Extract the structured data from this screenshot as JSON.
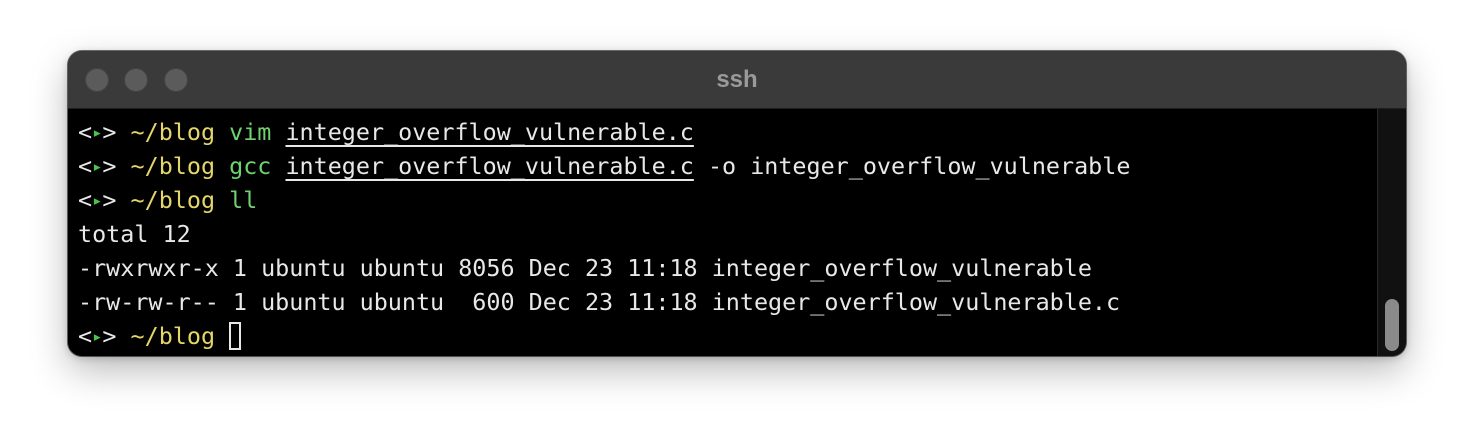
{
  "window": {
    "title": "ssh"
  },
  "colors": {
    "prompt_arrow": "#4cc34c",
    "directory": "#e5d66a",
    "command": "#6fd16f",
    "text": "#e8e8e8",
    "background": "#000000"
  },
  "terminal": {
    "prompt": {
      "lt": "<",
      "arrow": "▸",
      "gt": ">",
      "dir": "~/blog"
    },
    "lines": [
      {
        "cmd": "vim",
        "arg": "integer_overflow_vulnerable.c",
        "rest": ""
      },
      {
        "cmd": "gcc",
        "arg": "integer_overflow_vulnerable.c",
        "rest": " -o integer_overflow_vulnerable"
      },
      {
        "cmd": "ll",
        "arg": "",
        "rest": ""
      }
    ],
    "output": [
      "total 12",
      "-rwxrwxr-x 1 ubuntu ubuntu 8056 Dec 23 11:18 integer_overflow_vulnerable",
      "-rw-rw-r-- 1 ubuntu ubuntu  600 Dec 23 11:18 integer_overflow_vulnerable.c"
    ]
  }
}
